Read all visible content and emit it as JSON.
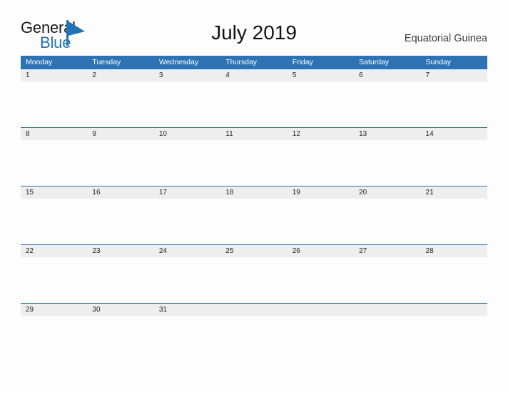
{
  "brand": {
    "name_part1": "General",
    "name_part2": "Blue",
    "flag_icon": "flag-triangle-icon",
    "color_dark": "#1b1b1b",
    "color_blue": "#2273b5"
  },
  "header": {
    "title": "July 2019",
    "locale": "Equatorial Guinea"
  },
  "theme": {
    "header_blue": "#2d73b3",
    "date_strip_gray": "#eeeeee",
    "page_background": "#fdfdfd",
    "text_dark": "#1e1e1e"
  },
  "calendar": {
    "month": "July",
    "year": "2019",
    "first_day_of_week": "Monday",
    "weekdays": [
      "Monday",
      "Tuesday",
      "Wednesday",
      "Thursday",
      "Friday",
      "Saturday",
      "Sunday"
    ],
    "weeks": [
      {
        "dates": [
          "1",
          "2",
          "3",
          "4",
          "5",
          "6",
          "7"
        ]
      },
      {
        "dates": [
          "8",
          "9",
          "10",
          "11",
          "12",
          "13",
          "14"
        ]
      },
      {
        "dates": [
          "15",
          "16",
          "17",
          "18",
          "19",
          "20",
          "21"
        ]
      },
      {
        "dates": [
          "22",
          "23",
          "24",
          "25",
          "26",
          "27",
          "28"
        ]
      },
      {
        "dates": [
          "29",
          "30",
          "31",
          "",
          "",
          "",
          ""
        ]
      }
    ]
  }
}
